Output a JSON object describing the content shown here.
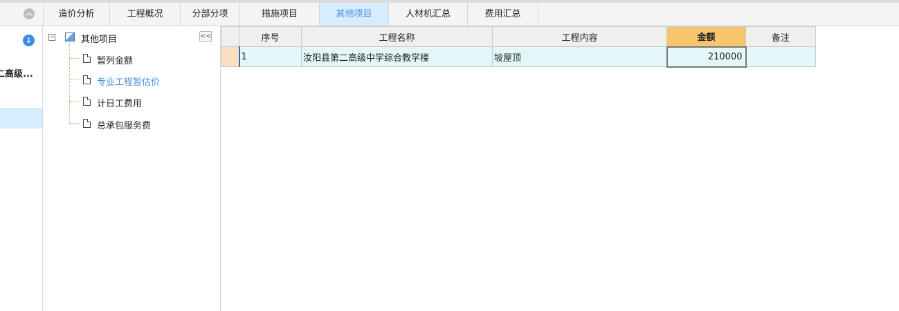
{
  "tabs": [
    {
      "label": "造价分析"
    },
    {
      "label": "工程概况"
    },
    {
      "label": "分部分项"
    },
    {
      "label": "措施项目"
    },
    {
      "label": "其他项目",
      "active": true
    },
    {
      "label": "人材机汇总"
    },
    {
      "label": "费用汇总"
    }
  ],
  "left_pane": {
    "project_label": "二高级..."
  },
  "tree": {
    "root_label": "其他项目",
    "items": [
      {
        "label": "暂列金额"
      },
      {
        "label": "专业工程暂估价",
        "selected": true
      },
      {
        "label": "计日工费用"
      },
      {
        "label": "总承包服务费"
      }
    ]
  },
  "grid": {
    "columns": [
      "序号",
      "工程名称",
      "工程内容",
      "金额",
      "备注"
    ],
    "rows": [
      {
        "seq": "1",
        "name": "汝阳县第二高级中学综合教学楼",
        "content": "坡屋顶",
        "amount": "210000",
        "note": ""
      }
    ]
  },
  "icons": {
    "collapse_up": "double-chevron-up-icon",
    "download": "download-circle-icon",
    "tree_collapse": "double-chevron-left-icon",
    "tree_toggle": "minus-box-icon",
    "tree_root": "image-folder-icon",
    "tree_doc": "document-icon"
  },
  "colors": {
    "active_tab_bg": "#d6ecff",
    "active_tab_text": "#4a90d9",
    "amount_header_bg": "#f7c56b",
    "row_bg": "#e3f7f9",
    "row_header_bg": "#fbe0c0"
  }
}
